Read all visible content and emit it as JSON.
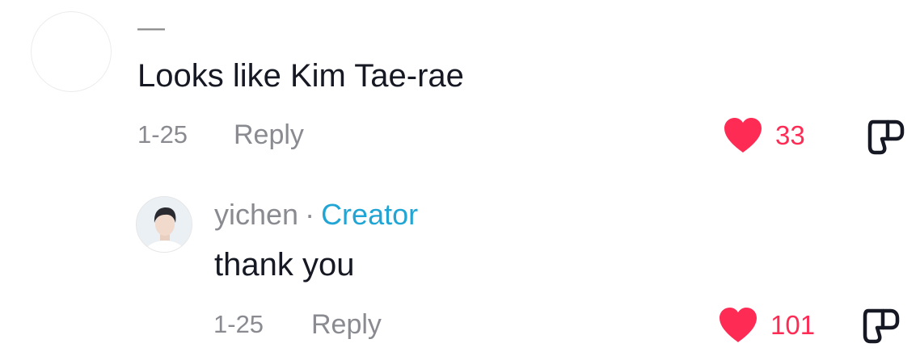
{
  "comment": {
    "username": "—",
    "text": "Looks like Kim Tae-rae",
    "date": "1-25",
    "reply_label": "Reply",
    "likes": "33",
    "like_icon": "heart-icon",
    "dislike_icon": "thumbs-down-icon"
  },
  "reply": {
    "username": "yichen",
    "separator": "·",
    "badge": "Creator",
    "text": "thank you",
    "date": "1-25",
    "reply_label": "Reply",
    "likes": "101",
    "like_icon": "heart-icon",
    "dislike_icon": "thumbs-down-icon"
  },
  "colors": {
    "like": "#fe2c55",
    "creator": "#20a5d4",
    "meta": "#8a8b91",
    "text": "#161823"
  }
}
